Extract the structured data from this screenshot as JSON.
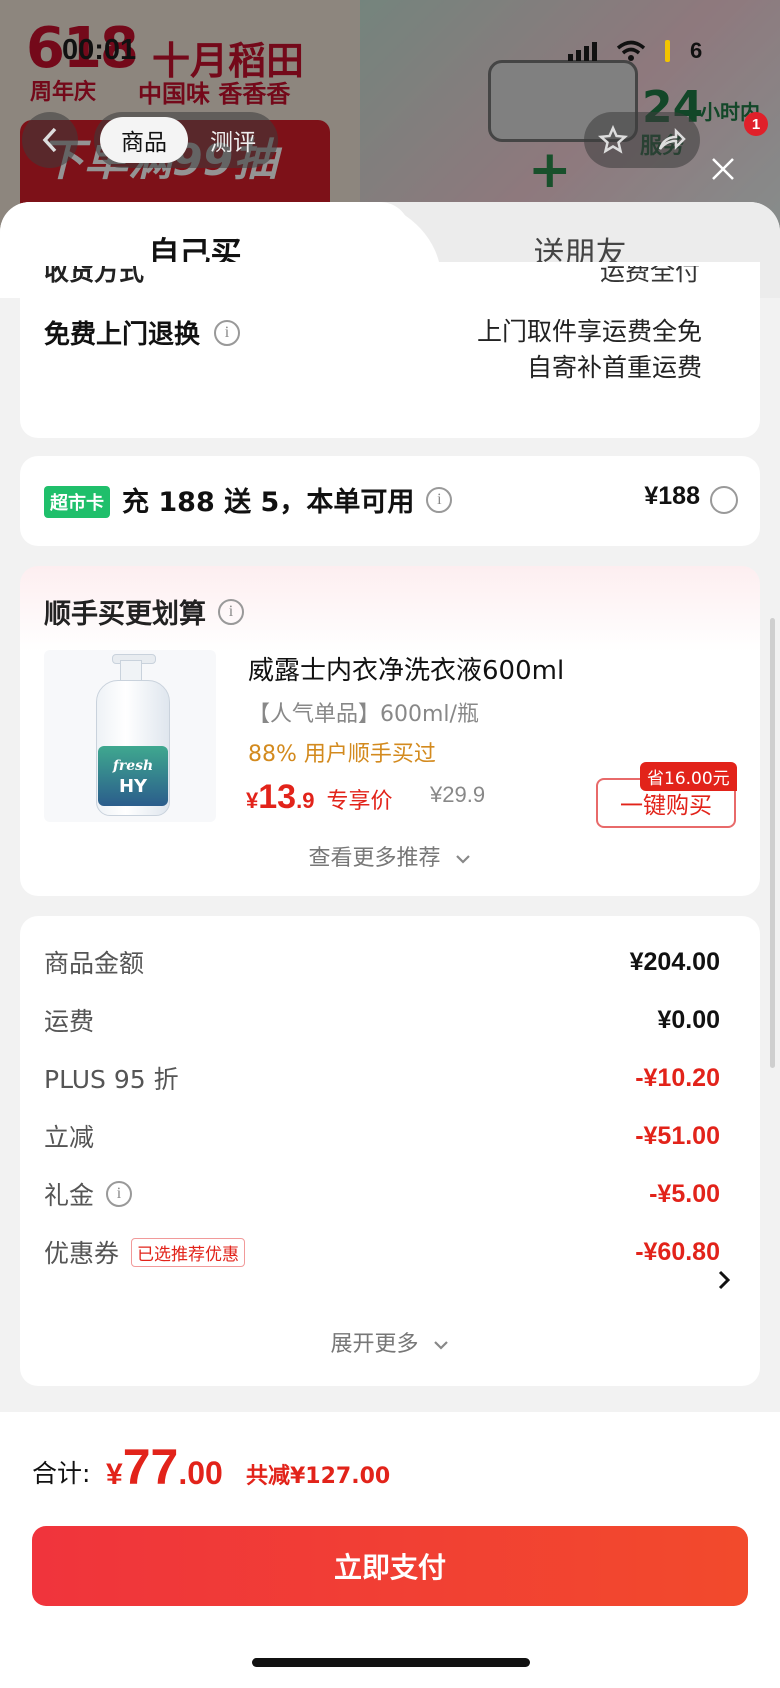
{
  "status_bar": {
    "time": "00:01",
    "battery": "6"
  },
  "background_page": {
    "banner_618": "618",
    "banner_anniversary": "周年庆",
    "brand": "十月稻田",
    "slogan": "中国味 香香香",
    "promo": "下单满99抽",
    "badge_24h": "24",
    "badge_24h_sub": "小时内",
    "badge_24h_sub2": "服务",
    "nav_tabs": [
      "商品",
      "测评"
    ],
    "cart_badge": "1"
  },
  "sheet": {
    "tabs": [
      {
        "label": "自己买",
        "active": true
      },
      {
        "label": "送朋友",
        "active": false
      }
    ],
    "delivery_section": {
      "cut_label": "收货方式",
      "cut_value": "运费全付",
      "return_label": "免费上门退换",
      "return_line1": "上门取件享运费全免",
      "return_line2": "自寄补首重运费"
    },
    "supermarket_card": {
      "tag": "超市卡",
      "text": "充 188 送 5，本单可用",
      "price": "¥188"
    },
    "recommend": {
      "title": "顺手买更划算",
      "product": {
        "image_brand_1": "fresh",
        "image_brand_2": "HY",
        "name": "威露士内衣净洗衣液600ml",
        "spec": "【人气单品】600ml/瓶",
        "buyers": "88% 用户顺手买过",
        "price_currency": "¥",
        "price_int": "13",
        "price_dec": ".9",
        "price_note": "专享价",
        "original_price": "¥29.9",
        "save_tag": "省16.00元",
        "buy_button": "一键购买"
      },
      "more": "查看更多推荐"
    },
    "summary": {
      "rows": [
        {
          "label": "商品金额",
          "value": "¥204.00",
          "red": false
        },
        {
          "label": "运费",
          "value": "¥0.00",
          "red": false
        },
        {
          "label": "PLUS 95 折",
          "value": "-¥10.20",
          "red": true
        },
        {
          "label": "立减",
          "value": "-¥51.00",
          "red": true
        },
        {
          "label": "礼金",
          "value": "-¥5.00",
          "red": true
        },
        {
          "label": "优惠券",
          "value": "-¥60.80",
          "red": true
        }
      ],
      "coupon_tag": "已选推荐优惠",
      "expand": "展开更多"
    }
  },
  "footer": {
    "total_label": "合计:",
    "total_currency": "¥",
    "total_int": "77",
    "total_dec": ".00",
    "total_saved": "共减¥127.00",
    "pay_button": "立即支付"
  },
  "colors": {
    "accent_red": "#e2231a",
    "green_tag": "#1fbf6b"
  }
}
